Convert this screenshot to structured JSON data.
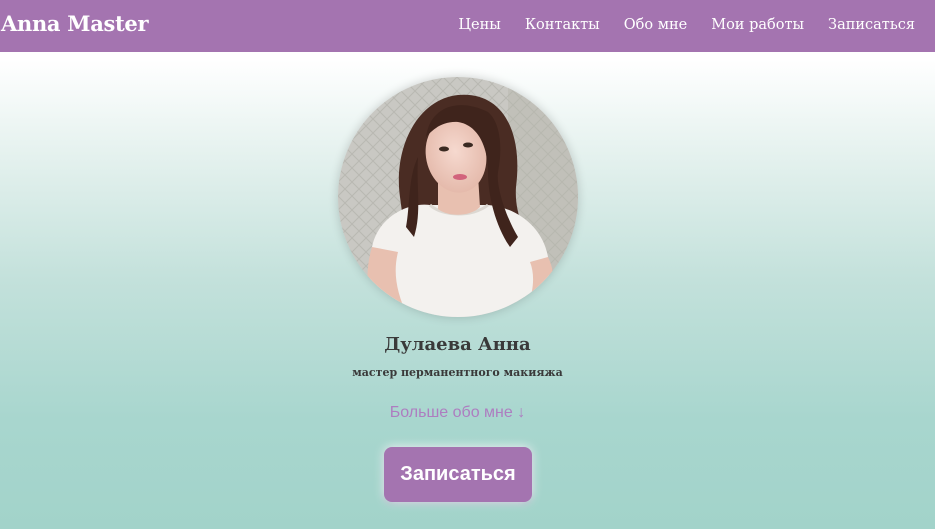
{
  "header": {
    "brand": "Anna Master",
    "nav": [
      {
        "label": "Цены"
      },
      {
        "label": "Контакты"
      },
      {
        "label": "Обо мне"
      },
      {
        "label": "Мои работы"
      },
      {
        "label": "Записаться"
      }
    ]
  },
  "hero": {
    "name": "Дулаева Анна",
    "role": "мастер перманентного макияжа",
    "more_link": "Больше обо мне ↓",
    "cta_label": "Записаться"
  },
  "colors": {
    "accent": "#a474b0",
    "link": "#ad7ec0",
    "text": "#3a3a3a",
    "bg_bottom": "#a2d3ca"
  }
}
